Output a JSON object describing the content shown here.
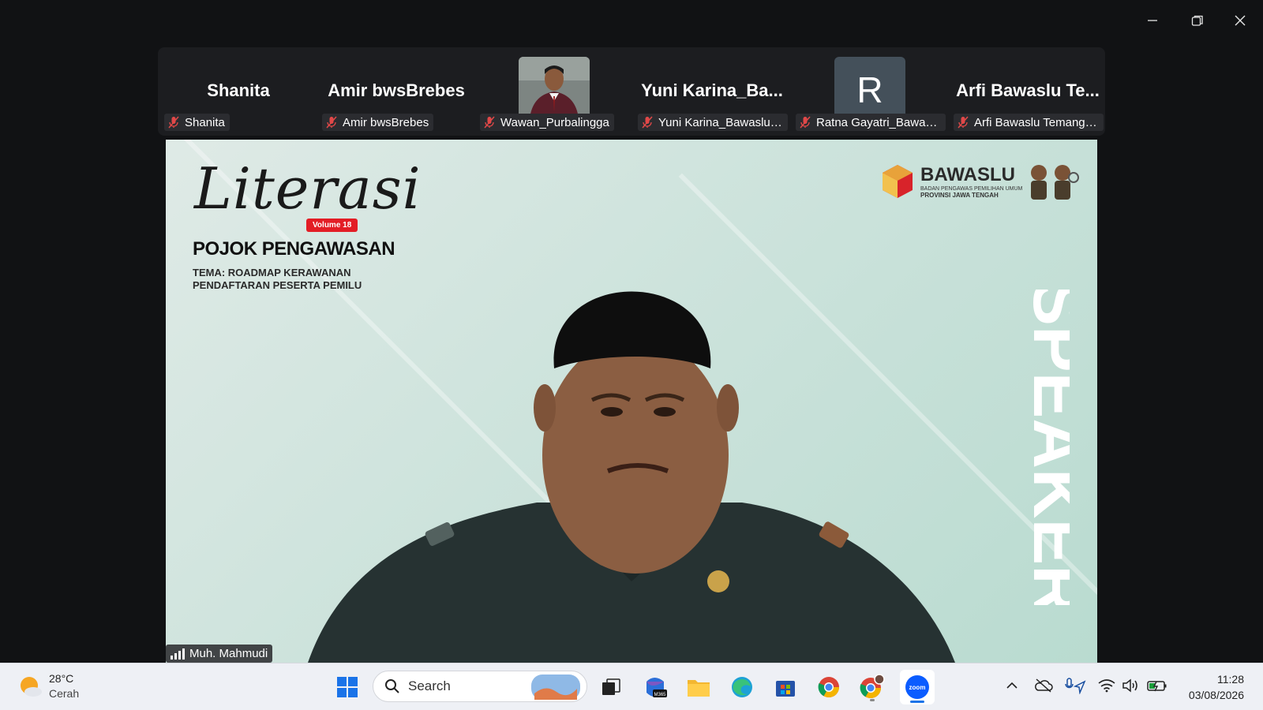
{
  "window": {
    "minimize_icon": "minimize-icon",
    "restore_icon": "restore-icon",
    "close_icon": "close-icon"
  },
  "participants": [
    {
      "display": "Shanita",
      "name": "Shanita",
      "type": "text"
    },
    {
      "display": "Amir bwsBrebes",
      "name": "Amir bwsBrebes",
      "type": "text"
    },
    {
      "display": "",
      "name": "Wawan_Purbalingga",
      "type": "photo"
    },
    {
      "display": "Yuni  Karina_Ba...",
      "name": "Yuni Karina_Bawaslu K...",
      "type": "text"
    },
    {
      "display": "R",
      "name": "Ratna Gayatri_Bawaslu...",
      "type": "letter"
    },
    {
      "display": "Arfi  Bawaslu  Te...",
      "name": "Arfi Bawaslu Temangg...",
      "type": "text"
    }
  ],
  "main_video": {
    "speaker_name": "Muh. Mahmudi",
    "slide": {
      "script_title": "Literasi",
      "volume": "Volume 18",
      "heading": "POJOK PENGAWASAN",
      "theme_line1": "TEMA: ROADMAP KERAWANAN",
      "theme_line2": "PENDAFTARAN PESERTA PEMILU",
      "logo_word": "BAWASLU",
      "logo_sub1": "BADAN PENGAWAS PEMILIHAN UMUM",
      "logo_sub2": "PROVINSI JAWA TENGAH",
      "side_word": "SPEAKER"
    }
  },
  "taskbar": {
    "weather": {
      "temp": "28°C",
      "condition": "Cerah"
    },
    "search_label": "Search",
    "apps": [
      "windows-start",
      "file-explorer",
      "microsoft-365",
      "folder",
      "edge",
      "store",
      "chrome",
      "chrome-profile",
      "zoom"
    ],
    "m365_label": "M365",
    "zoom_label": "zoom",
    "clock": {
      "time": "11:28",
      "date": "03/08/2026"
    }
  },
  "colors": {
    "accent": "#1a73e8",
    "muted_red": "#e04848",
    "zoom_blue": "#0b5cff"
  }
}
